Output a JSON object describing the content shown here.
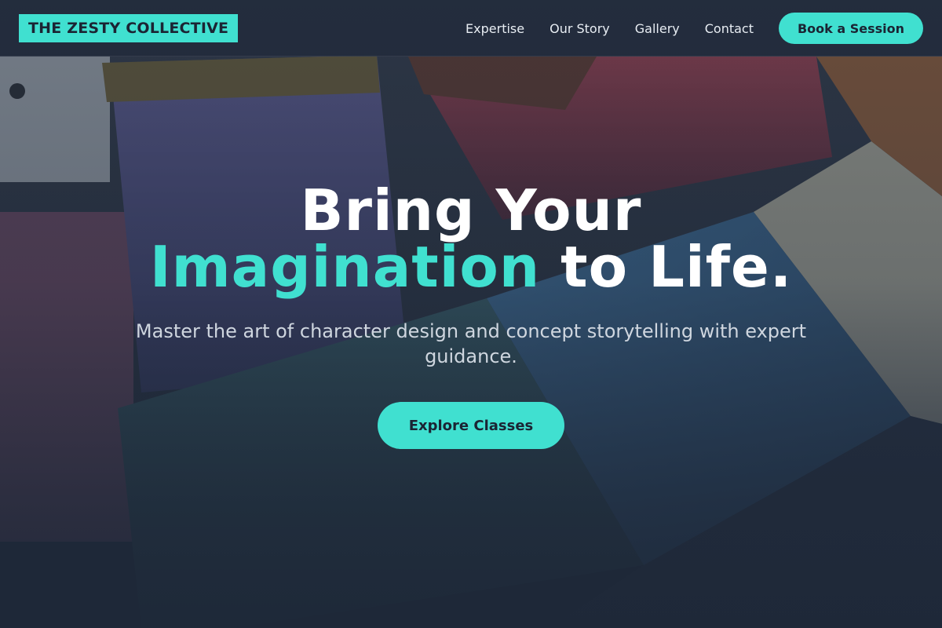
{
  "brand": {
    "logo_text": "THE ZESTY COLLECTIVE"
  },
  "nav": {
    "links": [
      "Expertise",
      "Our Story",
      "Gallery",
      "Contact"
    ],
    "cta_label": "Book a Session"
  },
  "hero": {
    "title_line1": "Bring Your",
    "title_accent": "Imagination",
    "title_rest": " to Life.",
    "subtitle": "Master the art of character design and concept storytelling with expert guidance.",
    "button_label": "Explore Classes",
    "background_image": "paintbrushes-photo"
  },
  "colors": {
    "accent": "#40e0d0",
    "navbar_bg": "#222c3c",
    "page_bg": "#1e2838",
    "text_light": "#ffffff",
    "text_muted": "#cfd6df"
  }
}
